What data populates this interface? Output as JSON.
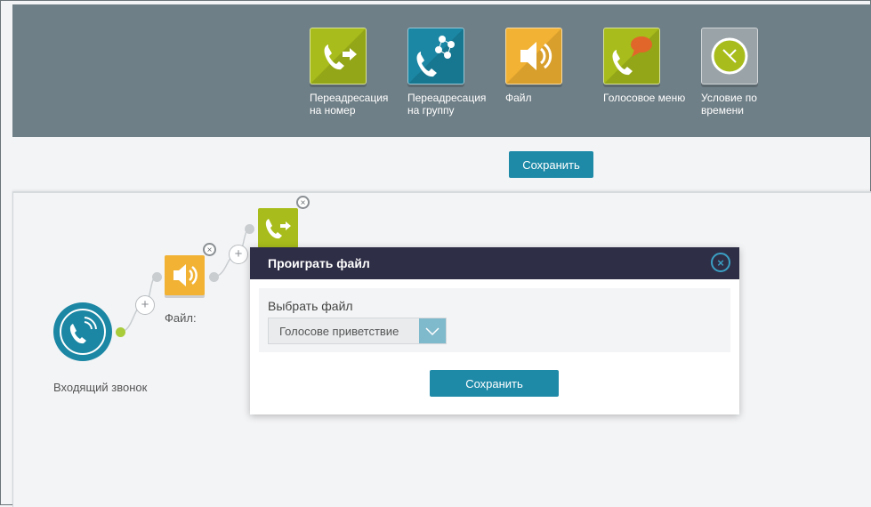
{
  "toolbar": {
    "tools": [
      {
        "label": "Переадресация на номер",
        "icon": "phone-forward-icon",
        "color": "#a8bd1b"
      },
      {
        "label": "Переадресация на группу",
        "icon": "phone-group-icon",
        "color": "#1b87a4"
      },
      {
        "label": "Файл",
        "icon": "speaker-icon",
        "color": "#f2b233"
      },
      {
        "label": "Голосовое меню",
        "icon": "phone-chat-icon",
        "color": "#a8bd1b"
      },
      {
        "label": "Условие по времени",
        "icon": "clock-icon",
        "color": "#9aa3a8"
      }
    ]
  },
  "save_top": "Сохранить",
  "flow": {
    "incoming_label": "Входящий звонок",
    "file_node_label": "Файл:",
    "plus": "+",
    "remove": "×"
  },
  "modal": {
    "title": "Проиграть файл",
    "close": "×",
    "field_label": "Выбрать файл",
    "selected_file": "Голосове приветствие",
    "save": "Сохранить"
  },
  "colors": {
    "toolbar_bg": "#6f7f87",
    "accent": "#1f8aa8",
    "modal_header": "#2f2e47"
  }
}
